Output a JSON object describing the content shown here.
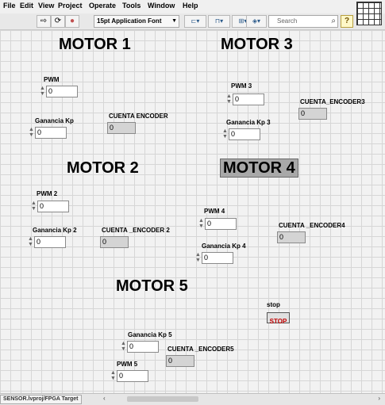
{
  "menu": {
    "items": [
      "File",
      "Edit",
      "View",
      "Project",
      "Operate",
      "Tools",
      "Window",
      "Help"
    ]
  },
  "toolbar": {
    "font_label": "15pt Application Font",
    "search_placeholder": "Search",
    "help_label": "?"
  },
  "panel": {
    "motor1": {
      "title": "MOTOR 1",
      "pwm_label": "PWM",
      "pwm_value": "0",
      "kp_label": "Ganancia  Kp",
      "kp_value": "0",
      "enc_label": "CUENTA ENCODER",
      "enc_value": "0"
    },
    "motor2": {
      "title": "MOTOR 2",
      "pwm_label": "PWM 2",
      "pwm_value": "0",
      "kp_label": "Ganancia  Kp 2",
      "kp_value": "0",
      "enc_label": "CUENTA _ENCODER 2",
      "enc_value": "0"
    },
    "motor3": {
      "title": "MOTOR 3",
      "pwm_label": "PWM 3",
      "pwm_value": "0",
      "kp_label": "Ganancia  Kp 3",
      "kp_value": "0",
      "enc_label": "CUENTA_ENCODER3",
      "enc_value": "0"
    },
    "motor4": {
      "title": "MOTOR 4",
      "pwm_label": "PWM 4",
      "pwm_value": "0",
      "kp_label": "Ganancia  Kp 4",
      "kp_value": "0",
      "enc_label": "CUENTA _ENCODER4",
      "enc_value": "0"
    },
    "motor5": {
      "title": "MOTOR 5",
      "pwm_label": "PWM 5",
      "pwm_value": "0",
      "kp_label": "Ganancia  Kp 5",
      "kp_value": "0",
      "enc_label": "CUENTA _ENCODER5",
      "enc_value": "0"
    },
    "stop": {
      "label": "stop",
      "button_text": "STOP"
    }
  },
  "statusbar": {
    "path": "SENSOR.lvproj/FPGA Target"
  }
}
